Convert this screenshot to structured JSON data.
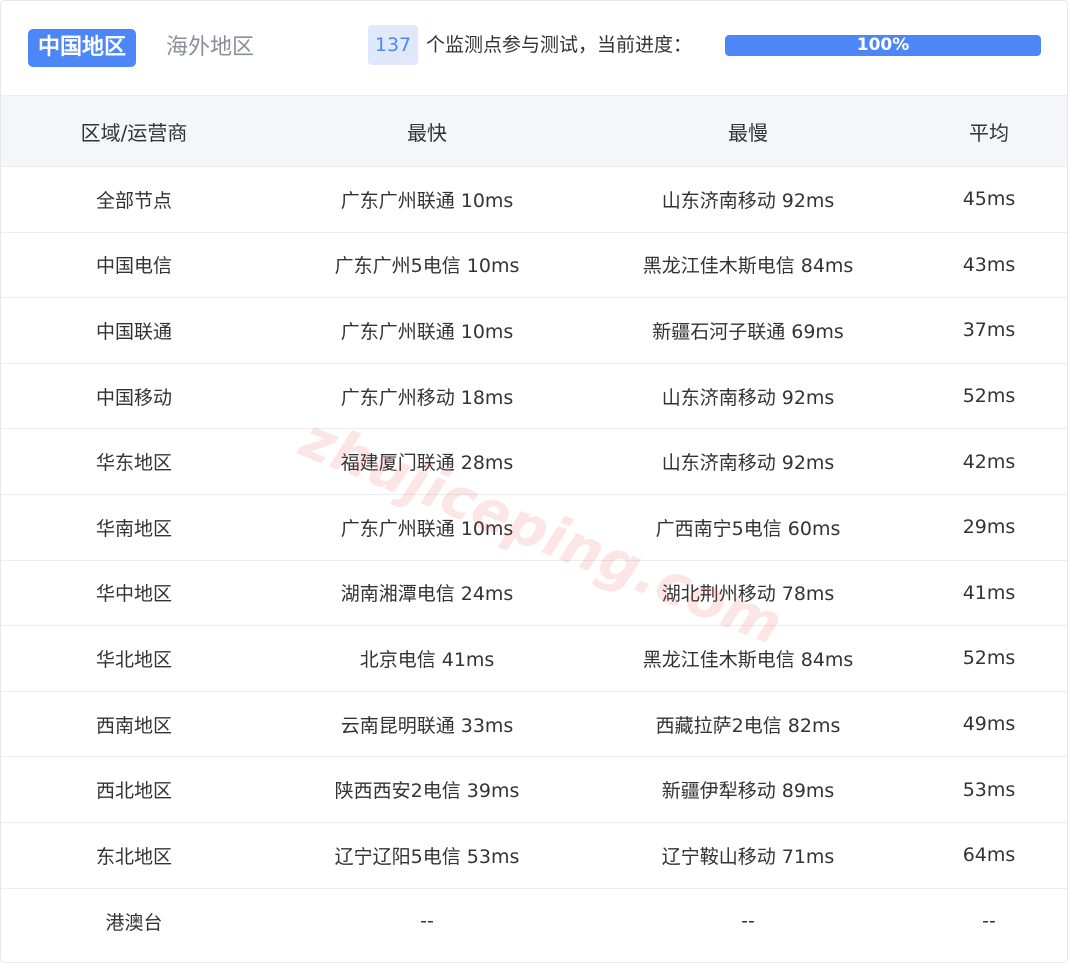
{
  "tabs": [
    {
      "label": "中国地区",
      "active": true
    },
    {
      "label": "海外地区",
      "active": false
    }
  ],
  "status": {
    "node_count": "137",
    "text": "个监测点参与测试，当前进度：",
    "progress_label": "100%",
    "progress_fraction": 1.0
  },
  "table": {
    "headers": [
      "区域/运营商",
      "最快",
      "最慢",
      "平均"
    ],
    "rows": [
      [
        "全部节点",
        "广东广州联通 10ms",
        "山东济南移动 92ms",
        "45ms"
      ],
      [
        "中国电信",
        "广东广州5电信 10ms",
        "黑龙江佳木斯电信 84ms",
        "43ms"
      ],
      [
        "中国联通",
        "广东广州联通 10ms",
        "新疆石河子联通 69ms",
        "37ms"
      ],
      [
        "中国移动",
        "广东广州移动 18ms",
        "山东济南移动 92ms",
        "52ms"
      ],
      [
        "华东地区",
        "福建厦门联通 28ms",
        "山东济南移动 92ms",
        "42ms"
      ],
      [
        "华南地区",
        "广东广州联通 10ms",
        "广西南宁5电信 60ms",
        "29ms"
      ],
      [
        "华中地区",
        "湖南湘潭电信 24ms",
        "湖北荆州移动 78ms",
        "41ms"
      ],
      [
        "华北地区",
        "北京电信 41ms",
        "黑龙江佳木斯电信 84ms",
        "52ms"
      ],
      [
        "西南地区",
        "云南昆明联通 33ms",
        "西藏拉萨2电信 82ms",
        "49ms"
      ],
      [
        "西北地区",
        "陕西西安2电信 39ms",
        "新疆伊犁移动 89ms",
        "53ms"
      ],
      [
        "东北地区",
        "辽宁辽阳5电信 53ms",
        "辽宁鞍山移动 71ms",
        "64ms"
      ],
      [
        "港澳台",
        "--",
        "--",
        "--"
      ]
    ]
  },
  "watermark": "zhujiceping.com",
  "colors": {
    "accent": "#4d87f7",
    "badge_bg": "#dfe9fb",
    "header_bg": "#f5f6f7",
    "watermark": "#eb4646"
  }
}
